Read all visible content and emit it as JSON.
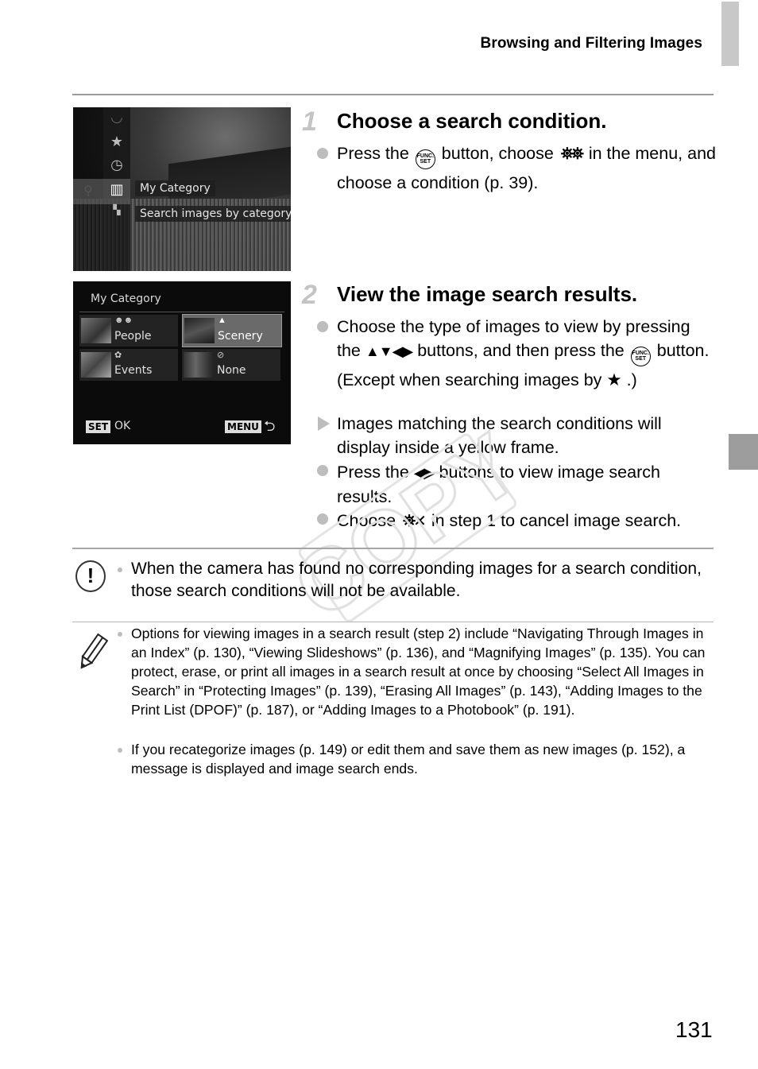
{
  "header": {
    "running_title": "Browsing and Filtering Images"
  },
  "screen1": {
    "menu_icons": [
      "self-timer-icon",
      "star-icon",
      "clock-icon",
      "my-category-icon",
      "scene-icon"
    ],
    "left_icons": [
      "binoculars-icon"
    ],
    "label_1": "My Category",
    "label_2": "Search images by category"
  },
  "screen2": {
    "title": "My Category",
    "categories": [
      {
        "label": "People",
        "icon": "people-icon",
        "selected": false
      },
      {
        "label": "Scenery",
        "icon": "scenery-icon",
        "selected": true
      },
      {
        "label": "Events",
        "icon": "events-icon",
        "selected": false
      },
      {
        "label": "None",
        "icon": "none-icon",
        "selected": false
      }
    ],
    "set_badge": "SET",
    "ok_label": "OK",
    "menu_badge": "MENU",
    "back_glyph": "⮌"
  },
  "step1": {
    "number": "1",
    "title": "Choose a search condition.",
    "bullet1_a": "Press the",
    "bullet1_b": "button, choose",
    "bullet1_c": "in the menu, and choose a condition (p. 39)."
  },
  "step2": {
    "number": "2",
    "title": "View the image search results.",
    "bullet1_a": "Choose the type of images to view by pressing the",
    "bullet1_arrows": "▲▼◀▶",
    "bullet1_b": "buttons, and then press the",
    "bullet1_c": "button. (Except when searching images by",
    "bullet1_star": "★",
    "bullet1_d": ".)",
    "result": "Images matching the search conditions will display inside a yellow frame.",
    "bullet2_a": "Press the",
    "bullet2_arrows": "◀▶",
    "bullet2_b": "buttons to view image search results.",
    "bullet3_a": "Choose",
    "bullet3_b": "in step 1 to cancel image search."
  },
  "func_icon": {
    "line1": "FUNC.",
    "line2": "SET"
  },
  "caution": {
    "text": "When the camera has found no corresponding images for a search condition, those search conditions will not be available."
  },
  "notes": [
    "Options for viewing images in a search result (step 2) include “Navigating Through Images in an Index” (p. 130), “Viewing Slideshows” (p. 136), and “Magnifying Images” (p. 135). You can protect, erase, or print all images in a search result at once by choosing “Select All Images in Search” in “Protecting Images” (p. 139), “Erasing All Images” (p. 143), “Adding Images to the Print List (DPOF)” (p. 187), or “Adding Images to a Photobook” (p. 191).",
    "If you recategorize images (p. 149) or edit them and save them as new images (p. 152), a message is displayed and image search ends."
  ],
  "watermark": "COPY",
  "page_number": "131"
}
